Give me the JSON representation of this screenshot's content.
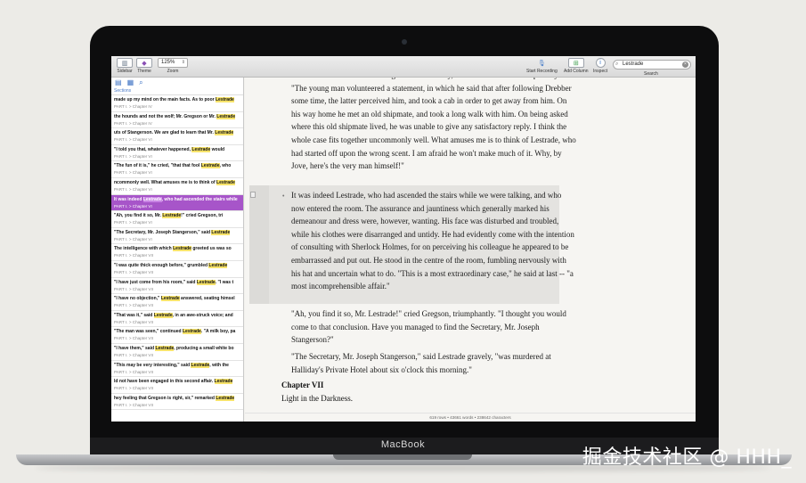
{
  "device": {
    "brand": "MacBook"
  },
  "watermark": "掘金技术社区 @ HHH_",
  "toolbar": {
    "sidebar_label": "Sidebar",
    "theme_label": "Theme",
    "zoom_label": "Zoom",
    "zoom_value": "125%",
    "record_label": "Start Recording",
    "add_column_label": "Add Column",
    "inspect_label": "Inspect",
    "search_value": "Lestrade",
    "search_label": "Search"
  },
  "sidebar": {
    "sections_label": "Sections",
    "results": [
      {
        "pre": "made up my mind on the main facts.  As to poor ",
        "hit": "Lestrade",
        "post": "",
        "loc": "PART I. > Chapter IV"
      },
      {
        "pre": "the hounds and not the wolf; Mr. Gregson or Mr. ",
        "hit": "Lestrade",
        "post": "",
        "loc": "PART I. > Chapter IV"
      },
      {
        "pre": "uts of Stangerson.  We are glad to learn that Mr. ",
        "hit": "Lestrade",
        "post": "",
        "loc": "PART I. > Chapter VI"
      },
      {
        "pre": "\"I told you that, whatever happened, ",
        "hit": "Lestrade",
        "post": " would",
        "loc": "PART I. > Chapter VI"
      },
      {
        "pre": "\"The fun of it is,\" he cried, \"that that fool ",
        "hit": "Lestrade",
        "post": ", who",
        "loc": "PART I. > Chapter VI"
      },
      {
        "pre": "ncommonly well.  What amuses me is to think of ",
        "hit": "Lestrade",
        "post": "",
        "loc": "PART I. > Chapter VI"
      },
      {
        "pre": "It was indeed ",
        "hit": "Lestrade",
        "post": ", who had ascended the stairs while",
        "loc": "PART I. > Chapter VI",
        "selected": true
      },
      {
        "pre": "\"Ah, you find it so, Mr. ",
        "hit": "Lestrade",
        "post": "!\" cried Gregson, tri",
        "loc": "PART I. > Chapter VI"
      },
      {
        "pre": "\"The Secretary, Mr. Joseph Stangerson,\" said ",
        "hit": "Lestrade",
        "post": "",
        "loc": "PART I. > Chapter VI"
      },
      {
        "pre": "The intelligence with which ",
        "hit": "Lestrade",
        "post": " greeted us was so",
        "loc": "PART I. > Chapter VII"
      },
      {
        "pre": "\"I was quite thick enough before,\" grumbled ",
        "hit": "Lestrade",
        "post": "",
        "loc": "PART I. > Chapter VII"
      },
      {
        "pre": "\"I have just come from his room,\" said ",
        "hit": "Lestrade",
        "post": ". \"I was t",
        "loc": "PART I. > Chapter VII"
      },
      {
        "pre": "\"I have no objection,\" ",
        "hit": "Lestrade",
        "post": " answered, seating himsel",
        "loc": "PART I. > Chapter VII"
      },
      {
        "pre": "\"That was it,\" said ",
        "hit": "Lestrade",
        "post": ", in an awe-struck voice; and",
        "loc": "PART I. > Chapter VII"
      },
      {
        "pre": "\"The man was seen,\" continued ",
        "hit": "Lestrade",
        "post": ". \"A milk boy, pa",
        "loc": "PART I. > Chapter VII"
      },
      {
        "pre": "\"I have them,\" said ",
        "hit": "Lestrade",
        "post": ", producing a small white bo",
        "loc": "PART I. > Chapter VII"
      },
      {
        "pre": "\"This may be very interesting,\" said ",
        "hit": "Lestrade",
        "post": ", with the",
        "loc": "PART I. > Chapter VII"
      },
      {
        "pre": "ld not have been engaged in this second affair.  ",
        "hit": "Lestrade",
        "post": "",
        "loc": "PART I. > Chapter VII"
      },
      {
        "pre": "hey feeling that Gregson is right, sir,\" remarked ",
        "hit": "Lestrade",
        "post": "",
        "loc": "PART I. > Chapter VII"
      }
    ]
  },
  "editor": {
    "para1": "\"Lestrade himself. I have managed it rather nicely,\" the detective answered proudly.  \"The young man volunteered a statement, in which he said that after following Drebber some time, the latter perceived him, and took a cab in order to get away from him.  On his way home he met an old shipmate, and took a long walk with him.  On being asked where this old shipmate lived, he was unable to give any satisfactory reply.  I think the whole case fits together uncommonly well.  What amuses me is to think of Lestrade, who had started off upon the wrong scent.  I am afraid he won't make much of it.  Why, by Jove, here's the very man himself!\"",
    "para2": "It was indeed Lestrade, who had ascended the stairs while we were talking, and who now entered the room.  The assurance and jauntiness which generally marked his demeanour and dress were, however, wanting.  His face was disturbed and troubled, while his clothes were disarranged and untidy.  He had evidently come with the intention of consulting with Sherlock Holmes, for on perceiving his colleague he appeared to be embarrassed and put out.  He stood in the centre of the room, fumbling nervously with his hat and uncertain what to do. \"This is a most extraordinary case,\" he said at last -- \"a most incomprehensible affair.\"",
    "para3": "\"Ah, you find it so, Mr. Lestrade!\" cried Gregson, triumphantly.  \"I thought you would come to that conclusion.  Have you managed to find the Secretary, Mr. Joseph Stangerson?\"",
    "para4": "\"The Secretary, Mr. Joseph Stangerson,\" said Lestrade gravely, \"was murdered at Halliday's Private Hotel about six o'clock this morning.\"",
    "chapter_title": "Chapter VII",
    "chapter_subtitle": "Light in the Darkness.",
    "status": "619 rows • 43661 words • 238642 characters"
  }
}
